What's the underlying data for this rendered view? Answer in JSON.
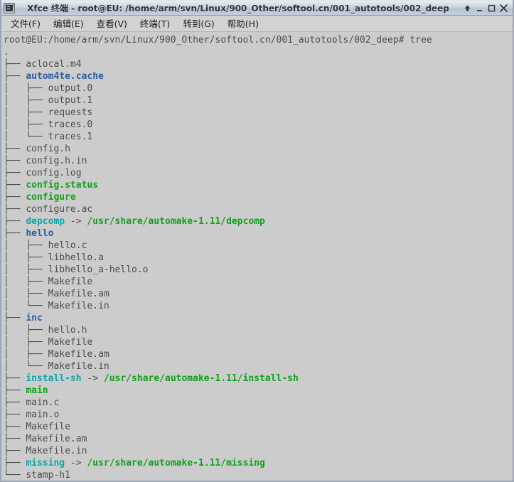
{
  "window": {
    "title": "Xfce 终端 - root@EU: /home/arm/svn/Linux/900_Other/softool.cn/001_autotools/002_deep",
    "icon": "terminal-icon",
    "buttons": {
      "shade": "↑",
      "minimize": "_",
      "maximize": "□",
      "close": "✕"
    }
  },
  "menubar": {
    "items": [
      {
        "label": "文件(F)"
      },
      {
        "label": "编辑(E)"
      },
      {
        "label": "查看(V)"
      },
      {
        "label": "终端(T)"
      },
      {
        "label": "转到(G)"
      },
      {
        "label": "帮助(H)"
      }
    ]
  },
  "terminal": {
    "colors": {
      "background": "#cccccc",
      "foreground": "#4d4d4d",
      "directory": "#2c5d9e",
      "executable": "#11a11b",
      "symlink": "#0aa7a7",
      "symlink_target": "#11a11b"
    },
    "prompt": "root@EU:/home/arm/svn/Linux/900_Other/softool.cn/001_autotools/002_deep# ",
    "command": "tree",
    "lines": [
      {
        "segments": [
          {
            "text": ".",
            "kind": "default"
          }
        ]
      },
      {
        "segments": [
          {
            "text": "├── ",
            "kind": "default"
          },
          {
            "text": "aclocal.m4",
            "kind": "default"
          }
        ]
      },
      {
        "segments": [
          {
            "text": "├── ",
            "kind": "default"
          },
          {
            "text": "autom4te.cache",
            "kind": "dir"
          }
        ]
      },
      {
        "segments": [
          {
            "text": "│   ├── ",
            "kind": "default"
          },
          {
            "text": "output.0",
            "kind": "default"
          }
        ]
      },
      {
        "segments": [
          {
            "text": "│   ├── ",
            "kind": "default"
          },
          {
            "text": "output.1",
            "kind": "default"
          }
        ]
      },
      {
        "segments": [
          {
            "text": "│   ├── ",
            "kind": "default"
          },
          {
            "text": "requests",
            "kind": "default"
          }
        ]
      },
      {
        "segments": [
          {
            "text": "│   ├── ",
            "kind": "default"
          },
          {
            "text": "traces.0",
            "kind": "default"
          }
        ]
      },
      {
        "segments": [
          {
            "text": "│   └── ",
            "kind": "default"
          },
          {
            "text": "traces.1",
            "kind": "default"
          }
        ]
      },
      {
        "segments": [
          {
            "text": "├── ",
            "kind": "default"
          },
          {
            "text": "config.h",
            "kind": "default"
          }
        ]
      },
      {
        "segments": [
          {
            "text": "├── ",
            "kind": "default"
          },
          {
            "text": "config.h.in",
            "kind": "default"
          }
        ]
      },
      {
        "segments": [
          {
            "text": "├── ",
            "kind": "default"
          },
          {
            "text": "config.log",
            "kind": "default"
          }
        ]
      },
      {
        "segments": [
          {
            "text": "├── ",
            "kind": "default"
          },
          {
            "text": "config.status",
            "kind": "exec"
          }
        ]
      },
      {
        "segments": [
          {
            "text": "├── ",
            "kind": "default"
          },
          {
            "text": "configure",
            "kind": "exec"
          }
        ]
      },
      {
        "segments": [
          {
            "text": "├── ",
            "kind": "default"
          },
          {
            "text": "configure.ac",
            "kind": "default"
          }
        ]
      },
      {
        "segments": [
          {
            "text": "├── ",
            "kind": "default"
          },
          {
            "text": "depcomp",
            "kind": "link"
          },
          {
            "text": " -> ",
            "kind": "arrow"
          },
          {
            "text": "/usr/share/automake-1.11/depcomp",
            "kind": "target"
          }
        ]
      },
      {
        "segments": [
          {
            "text": "├── ",
            "kind": "default"
          },
          {
            "text": "hello",
            "kind": "dir"
          }
        ]
      },
      {
        "segments": [
          {
            "text": "│   ├── ",
            "kind": "default"
          },
          {
            "text": "hello.c",
            "kind": "default"
          }
        ]
      },
      {
        "segments": [
          {
            "text": "│   ├── ",
            "kind": "default"
          },
          {
            "text": "libhello.a",
            "kind": "default"
          }
        ]
      },
      {
        "segments": [
          {
            "text": "│   ├── ",
            "kind": "default"
          },
          {
            "text": "libhello_a-hello.o",
            "kind": "default"
          }
        ]
      },
      {
        "segments": [
          {
            "text": "│   ├── ",
            "kind": "default"
          },
          {
            "text": "Makefile",
            "kind": "default"
          }
        ]
      },
      {
        "segments": [
          {
            "text": "│   ├── ",
            "kind": "default"
          },
          {
            "text": "Makefile.am",
            "kind": "default"
          }
        ]
      },
      {
        "segments": [
          {
            "text": "│   └── ",
            "kind": "default"
          },
          {
            "text": "Makefile.in",
            "kind": "default"
          }
        ]
      },
      {
        "segments": [
          {
            "text": "├── ",
            "kind": "default"
          },
          {
            "text": "inc",
            "kind": "dir"
          }
        ]
      },
      {
        "segments": [
          {
            "text": "│   ├── ",
            "kind": "default"
          },
          {
            "text": "hello.h",
            "kind": "default"
          }
        ]
      },
      {
        "segments": [
          {
            "text": "│   ├── ",
            "kind": "default"
          },
          {
            "text": "Makefile",
            "kind": "default"
          }
        ]
      },
      {
        "segments": [
          {
            "text": "│   ├── ",
            "kind": "default"
          },
          {
            "text": "Makefile.am",
            "kind": "default"
          }
        ]
      },
      {
        "segments": [
          {
            "text": "│   └── ",
            "kind": "default"
          },
          {
            "text": "Makefile.in",
            "kind": "default"
          }
        ]
      },
      {
        "segments": [
          {
            "text": "├── ",
            "kind": "default"
          },
          {
            "text": "install-sh",
            "kind": "link"
          },
          {
            "text": " -> ",
            "kind": "arrow"
          },
          {
            "text": "/usr/share/automake-1.11/install-sh",
            "kind": "target"
          }
        ]
      },
      {
        "segments": [
          {
            "text": "├── ",
            "kind": "default"
          },
          {
            "text": "main",
            "kind": "exec"
          }
        ]
      },
      {
        "segments": [
          {
            "text": "├── ",
            "kind": "default"
          },
          {
            "text": "main.c",
            "kind": "default"
          }
        ]
      },
      {
        "segments": [
          {
            "text": "├── ",
            "kind": "default"
          },
          {
            "text": "main.o",
            "kind": "default"
          }
        ]
      },
      {
        "segments": [
          {
            "text": "├── ",
            "kind": "default"
          },
          {
            "text": "Makefile",
            "kind": "default"
          }
        ]
      },
      {
        "segments": [
          {
            "text": "├── ",
            "kind": "default"
          },
          {
            "text": "Makefile.am",
            "kind": "default"
          }
        ]
      },
      {
        "segments": [
          {
            "text": "├── ",
            "kind": "default"
          },
          {
            "text": "Makefile.in",
            "kind": "default"
          }
        ]
      },
      {
        "segments": [
          {
            "text": "├── ",
            "kind": "default"
          },
          {
            "text": "missing",
            "kind": "link"
          },
          {
            "text": " -> ",
            "kind": "arrow"
          },
          {
            "text": "/usr/share/automake-1.11/missing",
            "kind": "target"
          }
        ]
      },
      {
        "segments": [
          {
            "text": "└── ",
            "kind": "default"
          },
          {
            "text": "stamp-h1",
            "kind": "default"
          }
        ]
      }
    ]
  }
}
